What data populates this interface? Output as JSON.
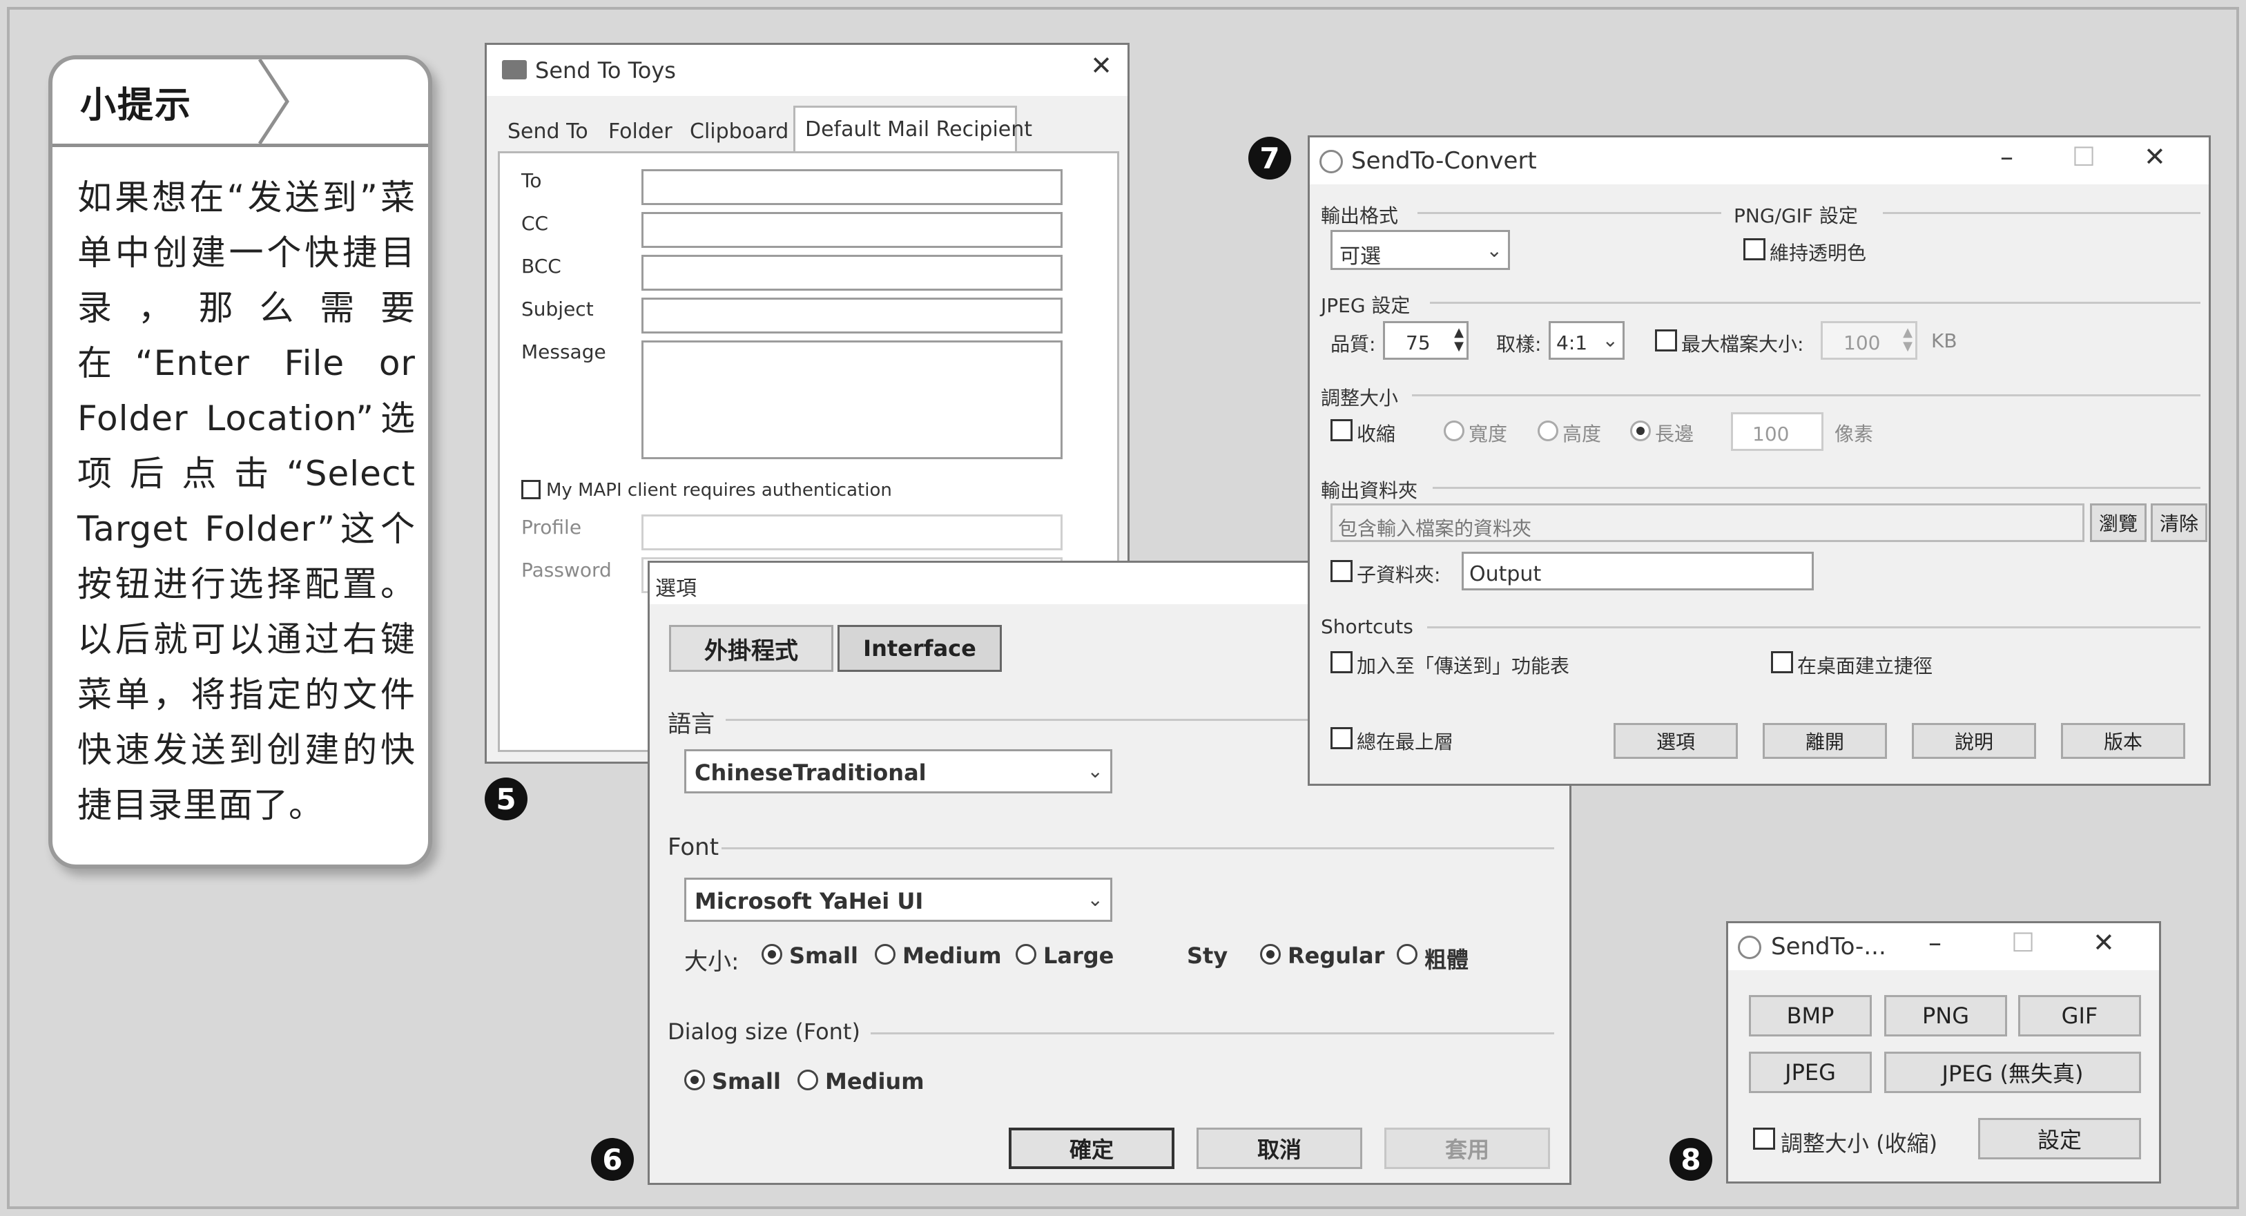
{
  "tip": {
    "title": "小提示",
    "body": "如果想在“发送到”菜单中创建一个快捷目录，那么需要在“Enter File or Folder Location”选项后点击“Select Target Folder”这个按钮进行选择配置。以后就可以通过右键菜单，将指定的文件快速发送到创建的快捷目录里面了。"
  },
  "markers": {
    "m5": "5",
    "m6": "6",
    "m7": "7",
    "m8": "8"
  },
  "win5": {
    "title": "Send To Toys",
    "tabs": [
      "Send To",
      "Folder",
      "Clipboard",
      "Default Mail Recipient"
    ],
    "labels": {
      "to": "To",
      "cc": "CC",
      "bcc": "BCC",
      "subject": "Subject",
      "message": "Message",
      "profile": "Profile",
      "password": "Password"
    },
    "mapi": "My MAPI client requires authentication"
  },
  "win6": {
    "title": "選項",
    "tabs": [
      "外掛程式",
      "Interface"
    ],
    "lang_section": "語言",
    "lang_value": "ChineseTraditional",
    "font_section": "Font",
    "font_value": "Microsoft YaHei UI",
    "size_label": "大小:",
    "sizes": [
      "Small",
      "Medium",
      "Large"
    ],
    "style_label": "Sty",
    "styles": [
      "Regular",
      "粗體"
    ],
    "dialog_section": "Dialog size (Font)",
    "dialog_sizes": [
      "Small",
      "Medium"
    ],
    "buttons": {
      "ok": "確定",
      "cancel": "取消",
      "apply": "套用"
    }
  },
  "win7": {
    "title": "SendTo-Convert",
    "output_format": "輸出格式",
    "format_value": "可選",
    "pnggif": "PNG/GIF 設定",
    "keep_transparent": "維持透明色",
    "jpeg": "JPEG 設定",
    "quality_label": "品質:",
    "quality_value": "75",
    "sampling_label": "取樣:",
    "sampling_value": "4:1",
    "max_size": "最大檔案大小:",
    "max_size_value": "100",
    "kb": "KB",
    "resize": "調整大小",
    "shrink": "收縮",
    "width": "寬度",
    "height": "高度",
    "longest": "長邊",
    "resize_value": "100",
    "pixels": "像素",
    "output_folder": "輸出資料夾",
    "folder_value": "包含輸入檔案的資料夾",
    "browse": "瀏覽",
    "clear": "清除",
    "subfolder": "子資料夾:",
    "subfolder_value": "Output",
    "shortcuts": "Shortcuts",
    "add_sendto": "加入至「傳送到」功能表",
    "desktop_shortcut": "在桌面建立捷徑",
    "always_top": "總在最上層",
    "buttons": [
      "選項",
      "離開",
      "說明",
      "版本"
    ]
  },
  "win8": {
    "title": "SendTo-...",
    "formats": [
      "BMP",
      "PNG",
      "GIF",
      "JPEG",
      "JPEG (無失真)"
    ],
    "resize": "調整大小 (收縮)",
    "settings": "設定"
  }
}
